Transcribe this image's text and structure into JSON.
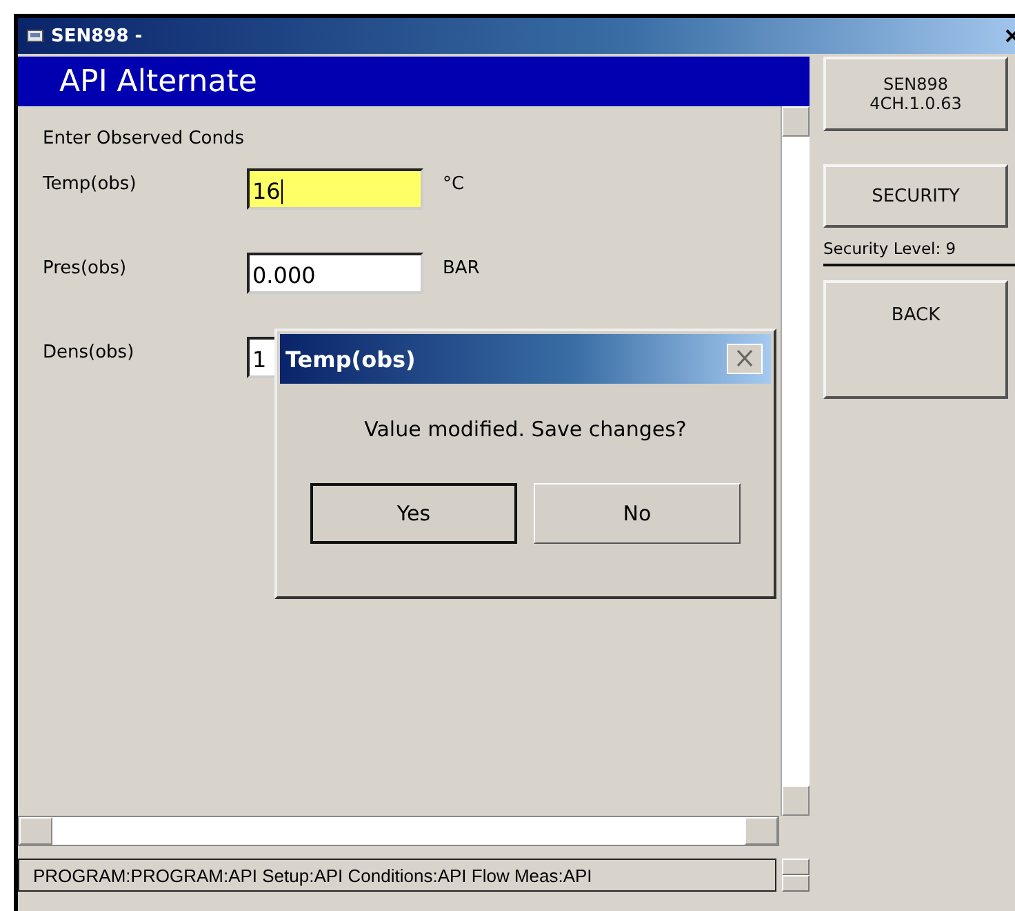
{
  "window": {
    "title": "SEN898 -"
  },
  "header": {
    "title": "API Alternate"
  },
  "form": {
    "heading": "Enter Observed Conds",
    "fields": [
      {
        "label": "Temp(obs)",
        "value": "16",
        "unit": "°C",
        "focused": true
      },
      {
        "label": "Pres(obs)",
        "value": "0.000",
        "unit": "BAR",
        "focused": false
      },
      {
        "label": "Dens(obs)",
        "value": "1",
        "focused": false
      }
    ]
  },
  "side_panel": {
    "device_button": [
      "SEN898",
      "4CH.1.0.63"
    ],
    "security_button": "SECURITY",
    "security_level": "Security Level: 9",
    "back_button": "BACK"
  },
  "dialog": {
    "title": "Temp(obs)",
    "message": "Value modified. Save changes?",
    "buttons": [
      {
        "label": "Yes",
        "default": true
      },
      {
        "label": "No",
        "default": false
      }
    ]
  },
  "status_bar": {
    "path": "PROGRAM:PROGRAM:API Setup:API Conditions:API Flow Meas:API"
  }
}
